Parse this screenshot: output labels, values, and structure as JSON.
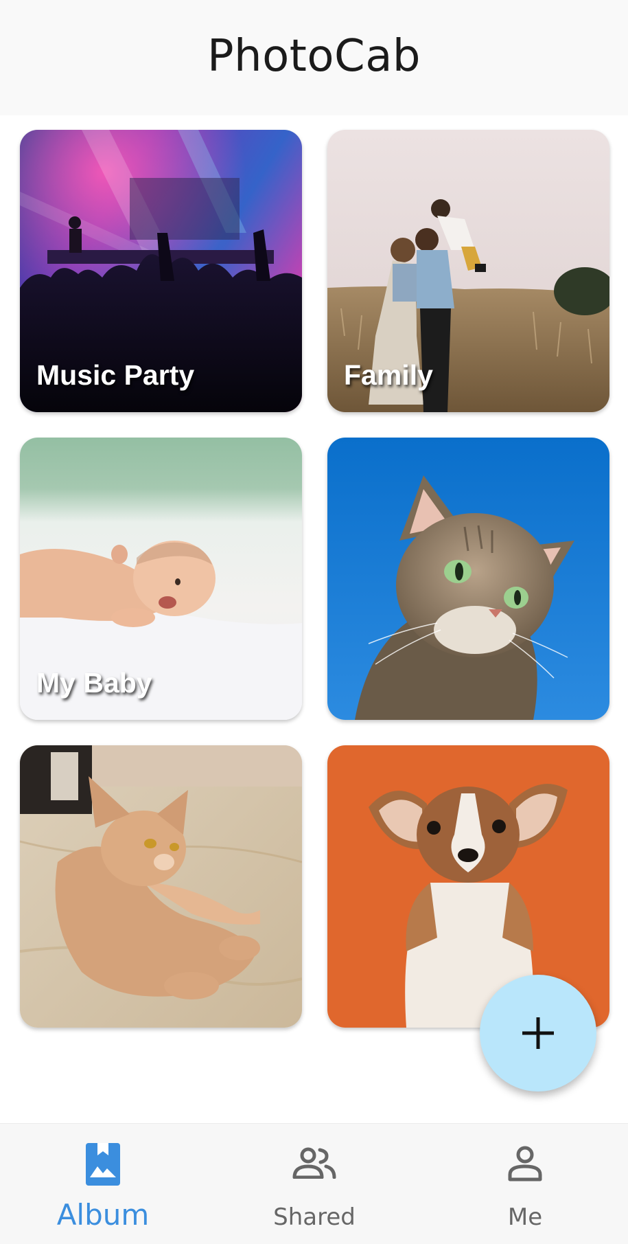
{
  "app": {
    "title": "PhotoCab"
  },
  "albums": [
    {
      "label": "Music Party",
      "photo_subject": "concert crowd under stage lights"
    },
    {
      "label": "Family",
      "photo_subject": "parents lifting child in a field"
    },
    {
      "label": "My Baby",
      "photo_subject": "smiling baby lying on a blanket"
    },
    {
      "label": "",
      "photo_subject": "tabby cat against blue sky"
    },
    {
      "label": "",
      "photo_subject": "ginger cat lying on marble floor"
    },
    {
      "label": "",
      "photo_subject": "corgi puppy on orange background"
    }
  ],
  "fab": {
    "icon": "plus-icon",
    "background": "#b9e6fb"
  },
  "bottom_nav": {
    "items": [
      {
        "label": "Album",
        "icon": "album-icon",
        "active": true
      },
      {
        "label": "Shared",
        "icon": "people-icon",
        "active": false
      },
      {
        "label": "Me",
        "icon": "person-icon",
        "active": false
      }
    ],
    "active_color": "#3b8ede",
    "inactive_color": "#666666"
  }
}
